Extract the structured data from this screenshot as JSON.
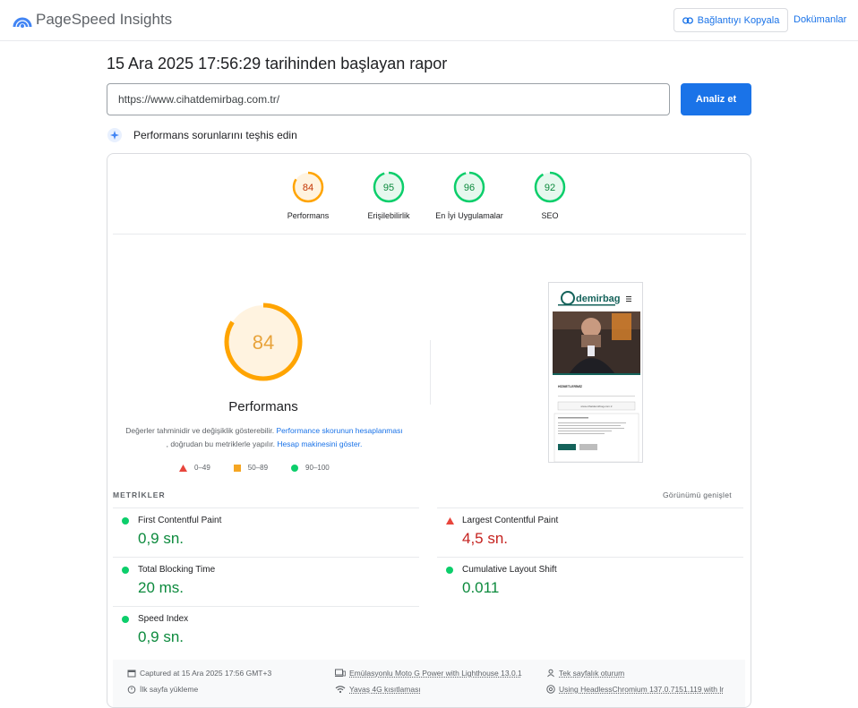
{
  "header": {
    "brand": "PageSpeed Insights",
    "copy_link": "Bağlantıyı Kopyala",
    "docs": "Dokümanlar"
  },
  "report": {
    "title": "15 Ara 2025 17:56:29 tarihinden başlayan rapor",
    "url_value": "https://www.cihatdemirbag.com.tr/",
    "analyze_label": "Analiz et",
    "diagnose_label": "Performans sorunlarını teşhis edin"
  },
  "scores": [
    {
      "label": "Performans",
      "value": "84",
      "status": "average"
    },
    {
      "label": "Erişilebilirlik",
      "value": "95",
      "status": "good"
    },
    {
      "label": "En İyi Uygulamalar",
      "value": "96",
      "status": "good"
    },
    {
      "label": "SEO",
      "value": "92",
      "status": "good"
    }
  ],
  "performance": {
    "score": "84",
    "title": "Performans",
    "desc_1": "Değerler tahminidir ve değişiklik gösterebilir. ",
    "desc_link_1": "Performance skorunun hesaplanması",
    "desc_2": " , doğrudan bu metriklerle yapılır. ",
    "desc_link_2": "Hesap makinesini göster."
  },
  "legend": [
    {
      "label": "0–49",
      "shape": "triangle",
      "color": "#e8453c"
    },
    {
      "label": "50–89",
      "shape": "square",
      "color": "#f5a623"
    },
    {
      "label": "90–100",
      "shape": "circle",
      "color": "#0cce6b"
    }
  ],
  "metrics_section": {
    "header": "METRİKLER",
    "expand": "Görünümü genişlet"
  },
  "metrics": [
    {
      "name": "First Contentful Paint",
      "value": "0,9 sn.",
      "status": "good"
    },
    {
      "name": "Largest Contentful Paint",
      "value": "4,5 sn.",
      "status": "bad"
    },
    {
      "name": "Total Blocking Time",
      "value": "20 ms.",
      "status": "good"
    },
    {
      "name": "Cumulative Layout Shift",
      "value": "0.011",
      "status": "good"
    },
    {
      "name": "Speed Index",
      "value": "0,9 sn.",
      "status": "good"
    }
  ],
  "footer": {
    "captured": "Captured at 15 Ara 2025 17:56 GMT+3",
    "first_load": "İlk sayfa yükleme",
    "device": "Emülasyonlu Moto G Power with Lighthouse 13.0.1",
    "throttle": "Yavaş 4G kısıtlaması",
    "session": "Tek sayfalık oturum",
    "browser": "Using HeadlessChromium 137.0.7151.119 with lr"
  },
  "screenshot_preview": {
    "site_logo": "demirbag",
    "section_label": "HİZMETLERİMİZ",
    "url_strip": "www.cihatdemirbag.com.tr"
  },
  "colors": {
    "accent": "#1a73e8",
    "good": "#0cce6b",
    "average": "#ffa400",
    "bad": "#e8453c"
  }
}
